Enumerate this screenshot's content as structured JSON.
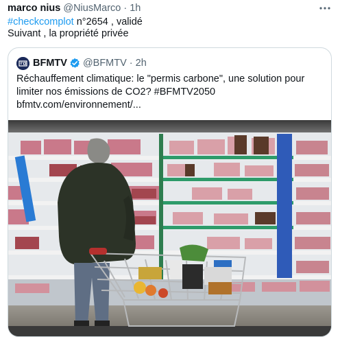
{
  "tweet": {
    "author_name": "marco nius",
    "author_handle": "@NiusMarco",
    "separator": "·",
    "time": "1h",
    "hashtag": "#checkcomplot",
    "line1_rest": " n°2654 , validé",
    "line2": "Suivant , la propriété privée",
    "more_icon": "more-icon"
  },
  "quote": {
    "author_name": "BFMTV",
    "author_handle": "@BFMTV",
    "separator": "·",
    "time": "2h",
    "text_line1": "Réchauffement climatique: le \"permis carbone\", une solution pour",
    "text_line2": "limiter nos émissions de CO2? #BFMTV2050",
    "text_line3": "bfmtv.com/environnement/...",
    "verified_color": "#1d9bf0"
  },
  "colors": {
    "link": "#1d9bf0",
    "secondary_text": "#536471",
    "border": "#cfd9de"
  }
}
